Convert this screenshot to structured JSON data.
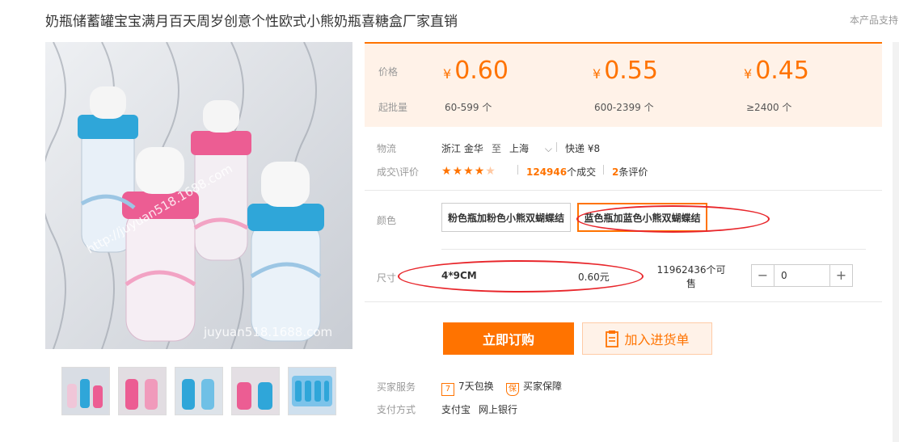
{
  "product": {
    "title": "奶瓶储蓄罐宝宝满月百天周岁创意个性欧式小熊奶瓶喜糖盒厂家直销",
    "side_note": "本产品支持",
    "watermark_url": "http://juyuan518.1688.com",
    "watermark_bottom": "juyuan518.1688.com",
    "thumbnail_count": 5
  },
  "pricing": {
    "price_label": "价格",
    "qty_label": "起批量",
    "currency": "¥",
    "tiers": [
      {
        "price": "0.60",
        "range": "60-599 个"
      },
      {
        "price": "0.55",
        "range": "600-2399 个"
      },
      {
        "price": "0.45",
        "range": "≥2400 个"
      }
    ]
  },
  "logistics": {
    "label": "物流",
    "from": "浙江 金华",
    "to_word": "至",
    "to": "上海",
    "method": "快递 ¥8"
  },
  "deals": {
    "label": "成交\\评价",
    "rating": 4.5,
    "count": "124946",
    "count_suffix": "个成交",
    "reviews": "2",
    "reviews_suffix": "条评价"
  },
  "color": {
    "label": "颜色",
    "options": [
      {
        "label": "粉色瓶加粉色小熊双蝴蝶结",
        "selected": false
      },
      {
        "label": "蓝色瓶加蓝色小熊双蝴蝶结",
        "selected": true
      }
    ]
  },
  "size": {
    "label": "尺寸",
    "name": "4*9CM",
    "price": "0.60元",
    "stock": "11962436个可售",
    "quantity": "0",
    "minus": "−",
    "plus": "+"
  },
  "actions": {
    "buy": "立即订购",
    "cart": "加入进货单"
  },
  "services": {
    "label": "买家服务",
    "items": [
      {
        "icon": "7-day-return-icon",
        "glyph": "7",
        "label": "7天包换"
      },
      {
        "icon": "buyer-protection-icon",
        "glyph": "保",
        "label": "买家保障"
      }
    ]
  },
  "payment": {
    "label": "支付方式",
    "methods": [
      "支付宝",
      "网上银行"
    ]
  },
  "accent": "#ff7300",
  "annotation_color": "#e8262b"
}
